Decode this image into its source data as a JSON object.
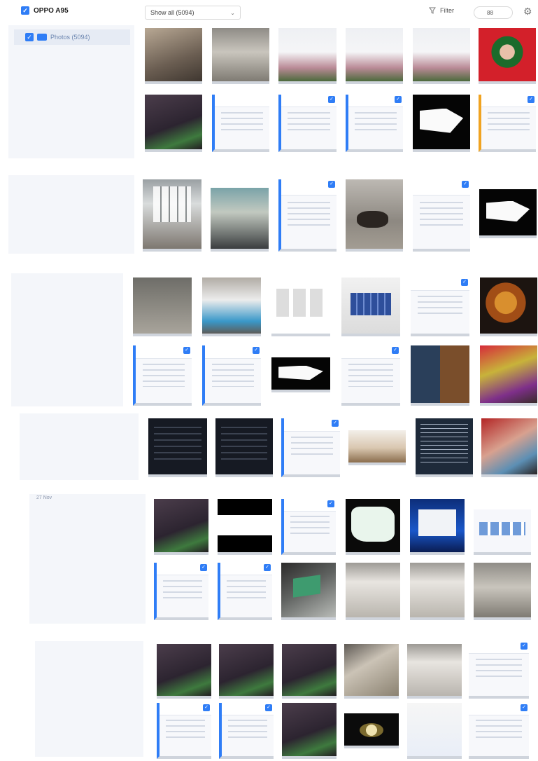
{
  "header": {
    "device_name": "OPPO A95",
    "filter_select_value": "Show all (5094)",
    "filter_label": "Filter",
    "zoom_value": "88"
  },
  "sidebar": {
    "album_label": "Photos (5094)"
  },
  "section_labels": {
    "section_5": "27 Nov"
  },
  "colors": {
    "accent": "#2f7df6",
    "panel_bg": "#f4f6fa",
    "album_highlight": "#e6ebf4"
  },
  "icons": {
    "device_checkbox": "checkbox-checked-icon",
    "album": "folder-icon",
    "filter": "funnel-icon",
    "settings": "gear-icon",
    "dropdown": "chevron-down-icon",
    "thumb_selected": "checkbox-checked-icon"
  }
}
